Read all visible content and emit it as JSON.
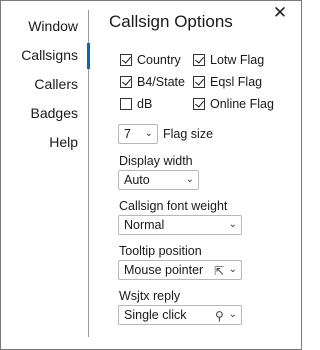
{
  "window": {
    "close_glyph": "✕"
  },
  "nav": {
    "items": [
      {
        "label": "Window"
      },
      {
        "label": "Callsigns",
        "selected": true
      },
      {
        "label": "Callers"
      },
      {
        "label": "Badges"
      },
      {
        "label": "Help"
      }
    ]
  },
  "page": {
    "title": "Callsign Options"
  },
  "checkboxes": {
    "country": {
      "label": "Country",
      "checked": true
    },
    "b4state": {
      "label": "B4/State",
      "checked": true
    },
    "db": {
      "label": "dB",
      "checked": false
    },
    "lotw": {
      "label": "Lotw Flag",
      "checked": true
    },
    "eqsl": {
      "label": "Eqsl Flag",
      "checked": true
    },
    "online": {
      "label": "Online Flag",
      "checked": true
    }
  },
  "flag_size": {
    "value": "7",
    "label": "Flag size"
  },
  "display_width": {
    "label": "Display width",
    "value": "Auto"
  },
  "font_weight": {
    "label": "Callsign font weight",
    "value": "Normal"
  },
  "tooltip_position": {
    "label": "Tooltip position",
    "value": "Mouse pointer",
    "icon": "mouse-pointer-icon"
  },
  "wsjtx_reply": {
    "label": "Wsjtx reply",
    "value": "Single click",
    "icon": "click-icon"
  },
  "colors": {
    "accent": "#0a64c8",
    "divider": "#9a9a9a"
  }
}
